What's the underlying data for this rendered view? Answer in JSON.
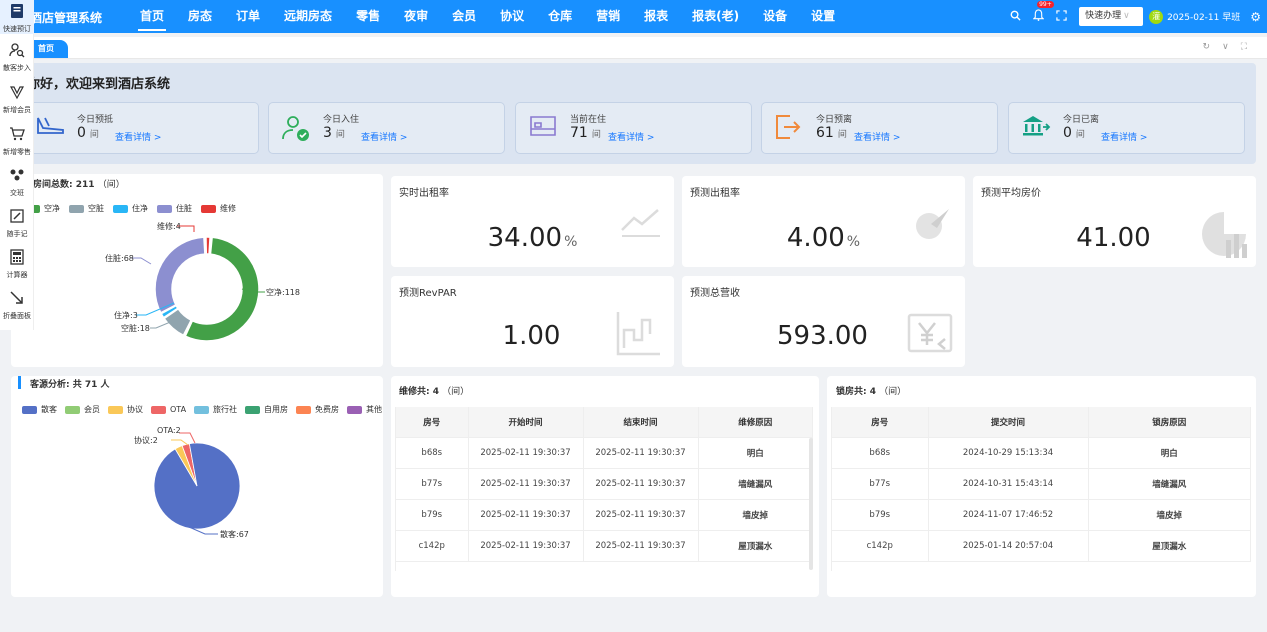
{
  "app": {
    "title": "酒店管理系统"
  },
  "nav": {
    "items": [
      "首页",
      "房态",
      "订单",
      "远期房态",
      "零售",
      "夜审",
      "会员",
      "协议",
      "仓库",
      "营销",
      "报表",
      "报表(老)",
      "设备",
      "设置"
    ]
  },
  "topbar": {
    "badge": "99+",
    "quick_action": "快速办理",
    "avatar_text": "灌",
    "date_text": "2025-02-11 早班"
  },
  "tabs": {
    "home": "首页"
  },
  "sidebar": {
    "items": [
      "快速预订",
      "散客步入",
      "新增会员",
      "新增零售",
      "交班",
      "随手记",
      "计算器",
      "折叠面板"
    ]
  },
  "welcome": {
    "text": "你好，欢迎来到酒店系统"
  },
  "stats": [
    {
      "label": "今日预抵",
      "value": "0",
      "unit": "间",
      "link": "查看详情 >"
    },
    {
      "label": "今日入住",
      "value": "3",
      "unit": "间",
      "link": "查看详情 >"
    },
    {
      "label": "当前在住",
      "value": "71",
      "unit": "间",
      "link": "查看详情 >"
    },
    {
      "label": "今日预离",
      "value": "61",
      "unit": "间",
      "link": "查看详情 >"
    },
    {
      "label": "今日已离",
      "value": "0",
      "unit": "间",
      "link": "查看详情 >"
    }
  ],
  "room_chart": {
    "title_prefix": "房间总数:",
    "total": "211",
    "title_suffix": "（间）",
    "legend": [
      {
        "name": "空净",
        "color": "#43a047"
      },
      {
        "name": "空脏",
        "color": "#90a4ae"
      },
      {
        "name": "住净",
        "color": "#29b6f6"
      },
      {
        "name": "住脏",
        "color": "#8c8fd0"
      },
      {
        "name": "维修",
        "color": "#e53935"
      }
    ],
    "labels": [
      "维修:4",
      "住脏:68",
      "住净:3",
      "空脏:18",
      "空净:118"
    ]
  },
  "source_chart": {
    "title_prefix": "客源分析: 共",
    "total": "71",
    "title_suffix": "人",
    "legend": [
      {
        "name": "散客",
        "color": "#5470c6"
      },
      {
        "name": "会员",
        "color": "#91cc75"
      },
      {
        "name": "协议",
        "color": "#fac858"
      },
      {
        "name": "OTA",
        "color": "#ee6666"
      },
      {
        "name": "旅行社",
        "color": "#73c0de"
      },
      {
        "name": "自用房",
        "color": "#3ba272"
      },
      {
        "name": "免费房",
        "color": "#fc8452"
      },
      {
        "name": "其他",
        "color": "#9a60b4"
      }
    ],
    "labels": [
      "OTA:2",
      "协议:2",
      "散客:67"
    ]
  },
  "chart_data": [
    {
      "type": "pie",
      "title": "房间总数: 211（间）",
      "categories": [
        "空净",
        "空脏",
        "住净",
        "住脏",
        "维修"
      ],
      "values": [
        118,
        18,
        3,
        68,
        4
      ],
      "legend": "top-left"
    },
    {
      "type": "pie",
      "title": "客源分析: 共71人",
      "categories": [
        "散客",
        "会员",
        "协议",
        "OTA",
        "旅行社",
        "自用房",
        "免费房",
        "其他"
      ],
      "values": [
        67,
        0,
        2,
        2,
        0,
        0,
        0,
        0
      ],
      "legend": "top-left"
    }
  ],
  "metrics": [
    {
      "title": "实时出租率",
      "value": "34.00",
      "suffix": "%"
    },
    {
      "title": "预测出租率",
      "value": "4.00",
      "suffix": "%"
    },
    {
      "title": "预测平均房价",
      "value": "41.00",
      "suffix": ""
    },
    {
      "title": "预测RevPAR",
      "value": "1.00",
      "suffix": ""
    },
    {
      "title": "预测总营收",
      "value": "593.00",
      "suffix": ""
    }
  ],
  "repair": {
    "title_prefix": "维修共:",
    "count": "4",
    "title_suffix": "（间）",
    "headers": [
      "房号",
      "开始时间",
      "结束时间",
      "维修原因"
    ],
    "rows": [
      [
        "b68s",
        "2025-02-11 19:30:37",
        "2025-02-11 19:30:37",
        "明白"
      ],
      [
        "b77s",
        "2025-02-11 19:30:37",
        "2025-02-11 19:30:37",
        "墙缝漏风"
      ],
      [
        "b79s",
        "2025-02-11 19:30:37",
        "2025-02-11 19:30:37",
        "墙皮掉"
      ],
      [
        "c142p",
        "2025-02-11 19:30:37",
        "2025-02-11 19:30:37",
        "屋顶漏水"
      ]
    ]
  },
  "locked": {
    "title_prefix": "锁房共:",
    "count": "4",
    "title_suffix": "（间）",
    "headers": [
      "房号",
      "提交时间",
      "锁房原因"
    ],
    "rows": [
      [
        "b68s",
        "2024-10-29 15:13:34",
        "明白"
      ],
      [
        "b77s",
        "2024-10-31 15:43:14",
        "墙缝漏风"
      ],
      [
        "b79s",
        "2024-11-07 17:46:52",
        "墙皮掉"
      ],
      [
        "c142p",
        "2025-01-14 20:57:04",
        "屋顶漏水"
      ]
    ]
  }
}
